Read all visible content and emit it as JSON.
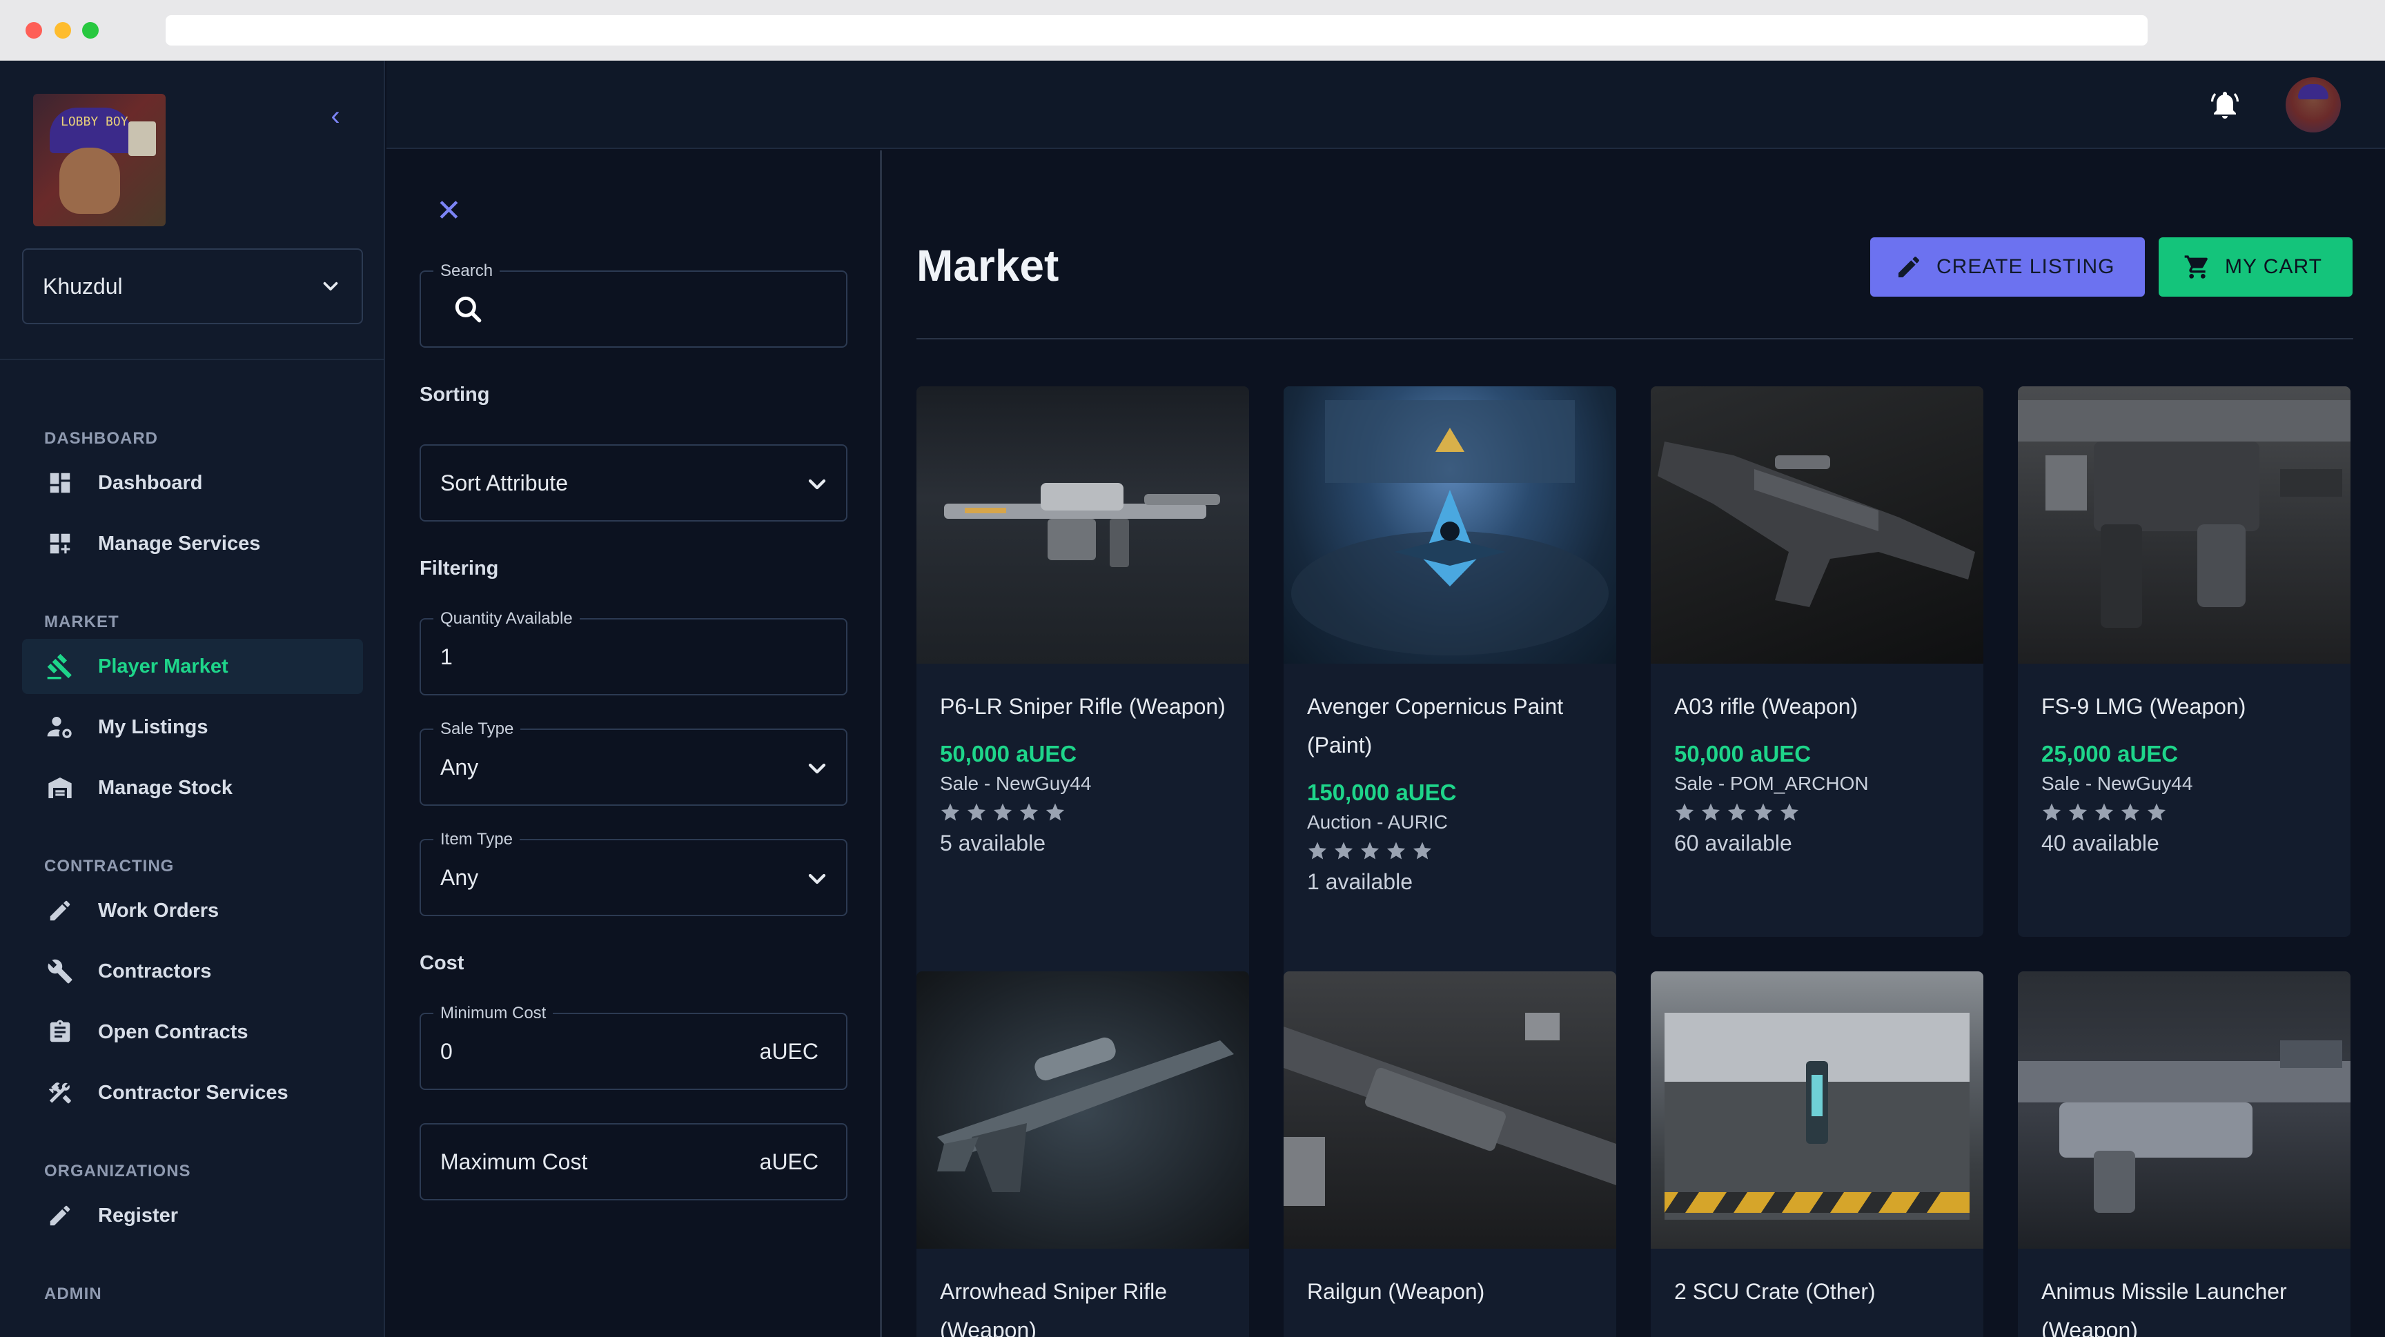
{
  "sidebar": {
    "user": "Khuzdul",
    "avatar_cap_text": "LOBBY BOY",
    "groups": [
      {
        "title": "DASHBOARD",
        "items": [
          {
            "label": "Dashboard",
            "icon": "dashboard-icon"
          },
          {
            "label": "Manage Services",
            "icon": "add-grid-icon"
          }
        ]
      },
      {
        "title": "MARKET",
        "items": [
          {
            "label": "Player Market",
            "icon": "gavel-icon",
            "active": true
          },
          {
            "label": "My Listings",
            "icon": "person-gear-icon"
          },
          {
            "label": "Manage Stock",
            "icon": "warehouse-icon"
          }
        ]
      },
      {
        "title": "CONTRACTING",
        "items": [
          {
            "label": "Work Orders",
            "icon": "pencil-icon"
          },
          {
            "label": "Contractors",
            "icon": "wrench-icon"
          },
          {
            "label": "Open Contracts",
            "icon": "clipboard-icon"
          },
          {
            "label": "Contractor Services",
            "icon": "tools-icon"
          }
        ]
      },
      {
        "title": "ORGANIZATIONS",
        "items": [
          {
            "label": "Register",
            "icon": "pencil-icon"
          }
        ]
      },
      {
        "title": "ADMIN",
        "items": []
      }
    ]
  },
  "filters": {
    "search_label": "Search",
    "sorting_title": "Sorting",
    "sort_value": "Sort Attribute",
    "filtering_title": "Filtering",
    "quantity_label": "Quantity Available",
    "quantity_value": "1",
    "sale_type_label": "Sale Type",
    "sale_type_value": "Any",
    "item_type_label": "Item Type",
    "item_type_value": "Any",
    "cost_title": "Cost",
    "min_cost_label": "Minimum Cost",
    "min_cost_value": "0",
    "max_cost_placeholder": "Maximum Cost",
    "currency": "aUEC"
  },
  "main": {
    "title": "Market",
    "create_label": "CREATE LISTING",
    "cart_label": "MY CART",
    "listings": [
      {
        "title": "P6-LR Sniper Rifle (Weapon)",
        "price": "50,000 aUEC",
        "seller": "Sale - NewGuy44",
        "available": "5 available",
        "rating": 5
      },
      {
        "title": "Avenger Copernicus Paint (Paint)",
        "price": "150,000 aUEC",
        "seller": "Auction - AURIC",
        "available": "1 available",
        "rating": 5
      },
      {
        "title": "A03 rifle (Weapon)",
        "price": "50,000 aUEC",
        "seller": "Sale - POM_ARCHON",
        "available": "60 available",
        "rating": 5
      },
      {
        "title": "FS-9 LMG (Weapon)",
        "price": "25,000 aUEC",
        "seller": "Sale - NewGuy44",
        "available": "40 available",
        "rating": 5
      },
      {
        "title": "Arrowhead Sniper Rifle (Weapon)"
      },
      {
        "title": "Railgun (Weapon)"
      },
      {
        "title": "2 SCU Crate (Other)"
      },
      {
        "title": "Animus Missile Launcher (Weapon)"
      }
    ]
  },
  "colors": {
    "accent": "#6c72f0",
    "success": "#14c47b",
    "price": "#1ed58a",
    "background": "#0c1220",
    "card": "#131c2d"
  }
}
